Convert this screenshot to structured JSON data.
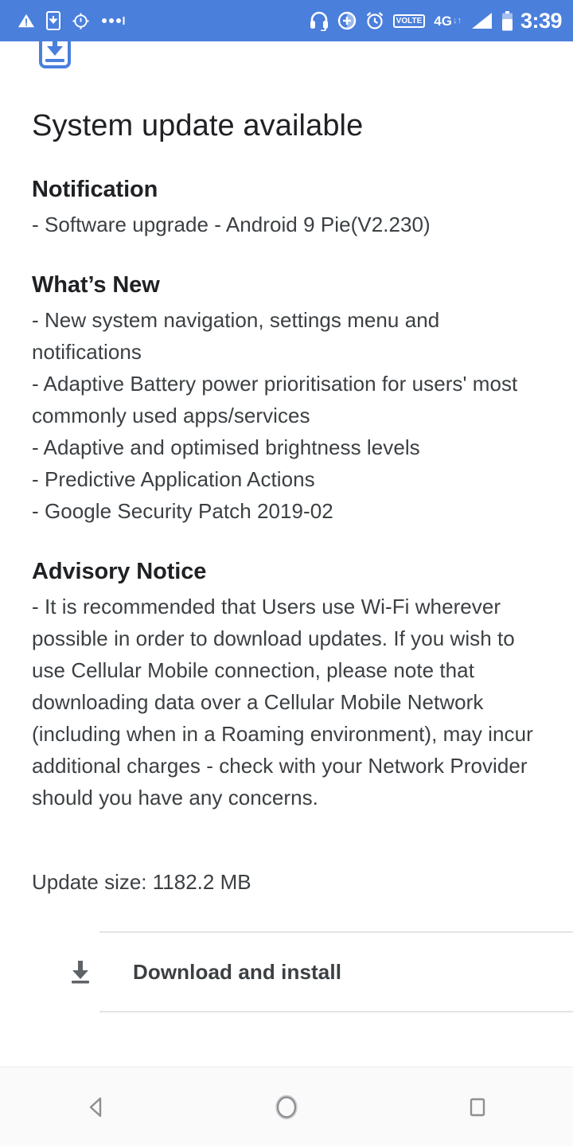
{
  "status_bar": {
    "background_color": "#4a7fdc",
    "foreground_color": "#ffffff",
    "left_icons": [
      {
        "name": "warning-triangle-icon",
        "label": "warning"
      },
      {
        "name": "phone-download-icon",
        "label": "software update ready"
      },
      {
        "name": "location-crosshair-icon",
        "label": "location"
      },
      {
        "name": "more-dots-icon",
        "label": "more notifications"
      }
    ],
    "right_icons": [
      {
        "name": "headset-icon",
        "label": "headset connected"
      },
      {
        "name": "accessibility-zoom-icon",
        "label": "magnification"
      },
      {
        "name": "alarm-clock-icon",
        "label": "alarm set"
      },
      {
        "name": "volte-icon",
        "label": "VoLTE"
      },
      {
        "name": "mobile-data-icon",
        "label": "4G"
      },
      {
        "name": "signal-bars-icon",
        "label": "signal"
      },
      {
        "name": "battery-icon",
        "label": "battery"
      }
    ],
    "volte": {
      "top": "VO",
      "bottom": "LTE"
    },
    "network_type": "4G",
    "data_arrows": "↓↑",
    "clock": "3:39"
  },
  "header": {
    "icon_name": "system-update-icon",
    "title": "System update available"
  },
  "sections": [
    {
      "id": "notification",
      "heading": "Notification",
      "lines": [
        "- Software upgrade - Android 9 Pie(V2.230)"
      ]
    },
    {
      "id": "whats-new",
      "heading": "What’s New",
      "lines": [
        "- New system navigation, settings menu and notifications",
        "- Adaptive Battery power prioritisation for users' most commonly used apps/services",
        "- Adaptive and optimised brightness levels",
        "- Predictive Application Actions",
        "- Google Security Patch 2019-02"
      ]
    },
    {
      "id": "advisory-notice",
      "heading": "Advisory Notice",
      "lines": [
        "- It is recommended that Users use Wi-Fi wherever possible in order to download updates. If you wish to use Cellular Mobile connection, please note that downloading data over a Cellular Mobile Network (including when in a Roaming environment), may incur additional charges - check with your Network Provider should you have any concerns."
      ]
    }
  ],
  "update_size": "Update size: 1182.2 MB",
  "action": {
    "icon_name": "download-icon",
    "label": "Download and install"
  },
  "nav_bar": {
    "background_color": "#fafafa",
    "back_label": "Back",
    "home_label": "Home",
    "recents_label": "Recent apps"
  }
}
